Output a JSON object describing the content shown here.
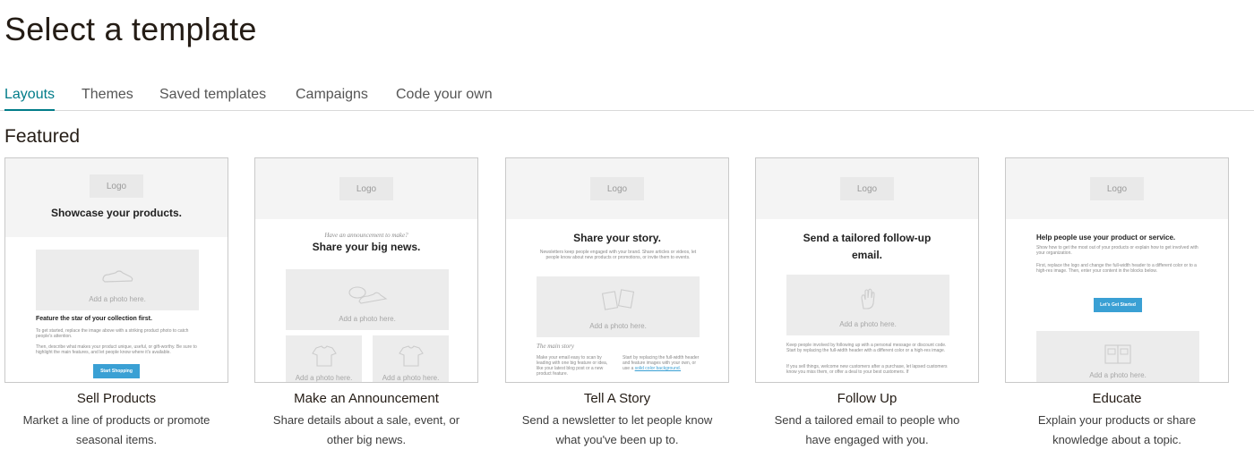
{
  "page_title": "Select a template",
  "tabs": [
    {
      "label": "Layouts",
      "active": true
    },
    {
      "label": "Themes",
      "active": false
    },
    {
      "label": "Saved templates",
      "active": false
    },
    {
      "label": "Campaigns",
      "active": false
    },
    {
      "label": "Code your own",
      "active": false
    }
  ],
  "section_title": "Featured",
  "colors": {
    "accent": "#007c89",
    "preview_button": "#3aa0d4"
  },
  "cards": [
    {
      "title": "Sell Products",
      "desc_1": "Market a line of products or promote",
      "desc_2": "seasonal items.",
      "preview": {
        "logo": "Logo",
        "heading": "Showcase your products.",
        "photo_label": "Add a photo here.",
        "subheading": "Feature the star of your collection first.",
        "body_1": "To get started, replace the image above with a striking product photo to catch people's attention.",
        "body_2": "Then, describe what makes your product unique, useful, or gift-worthy. Be sure to highlight the main features, and let people know where it's available.",
        "button": "Start Shopping"
      }
    },
    {
      "title": "Make an Announcement",
      "desc_1": "Share details about a sale, event, or",
      "desc_2": "other big news.",
      "preview": {
        "logo": "Logo",
        "kicker": "Have an announcement to make?",
        "heading": "Share your big news.",
        "photo_label": "Add a photo here.",
        "photo_label_2": "Add a photo here.",
        "photo_label_3": "Add a photo here."
      }
    },
    {
      "title": "Tell A Story",
      "desc_1": "Send a newsletter to let people know",
      "desc_2": "what you've been up to.",
      "preview": {
        "logo": "Logo",
        "heading": "Share your story.",
        "intro": "Newsletters keep people engaged with your brand. Share articles or videos, let people know about new products or promotions, or invite them to events.",
        "photo_label": "Add a photo here.",
        "section_label": "The main story",
        "col_1": "Make your email easy to scan by leading with one big feature or idea, like your latest blog post or a new product feature.",
        "col_2": "Start by replacing the full-width header and feature images with your own, or use a",
        "col_2_link": "solid color background."
      }
    },
    {
      "title": "Follow Up",
      "desc_1": "Send a tailored email to people who",
      "desc_2": "have engaged with you.",
      "preview": {
        "logo": "Logo",
        "heading_1": "Send a tailored follow-up",
        "heading_2": "email.",
        "photo_label": "Add a photo here.",
        "body_1": "Keep people involved by following up with a personal message or discount code. Start by replacing the full-width header with a different color or a high-res image.",
        "body_2": "If you sell things, welcome new customers after a purchase, let lapsed customers know you miss them, or offer a deal to your best customers. If"
      }
    },
    {
      "title": "Educate",
      "desc_1": "Explain your products or share",
      "desc_2": "knowledge about a topic.",
      "preview": {
        "logo": "Logo",
        "heading": "Help people use your product or service.",
        "body_1": "Show how to get the most out of your products or explain how to get involved with your organization.",
        "body_2": "First, replace the logo and change the full-width header to a different color or to a high-res image. Then, enter your content in the blocks below.",
        "button": "Let's Get Started",
        "photo_label": "Add a photo here."
      }
    }
  ]
}
